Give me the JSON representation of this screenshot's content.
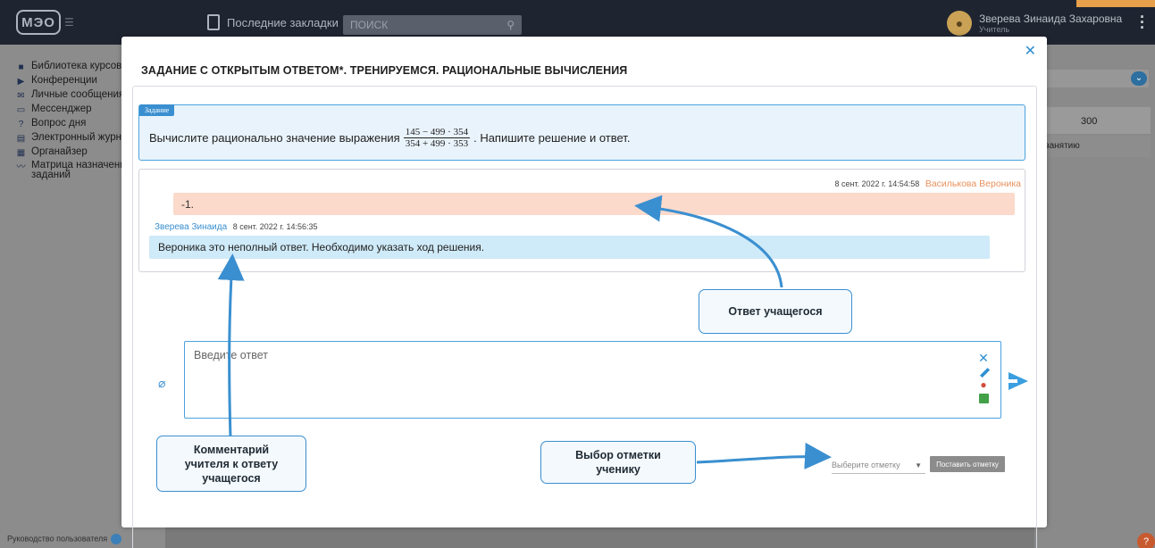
{
  "app": {
    "logo_text": "МЭО",
    "bookmarks_label": "Последние закладки",
    "search_placeholder": "ПОИСК",
    "user_name": "Зверева Зинаида Захаровна",
    "user_role": "Учитель"
  },
  "sidebar": {
    "items": [
      {
        "label": "Библиотека курсов",
        "icon": "book-icon"
      },
      {
        "label": "Конференции",
        "icon": "video-icon"
      },
      {
        "label": "Личные сообщения",
        "icon": "mail-icon"
      },
      {
        "label": "Мессенджер",
        "icon": "chat-icon"
      },
      {
        "label": "Вопрос дня",
        "icon": "question-icon"
      },
      {
        "label": "Электронный журнал",
        "icon": "journal-icon"
      },
      {
        "label": "Органайзер",
        "icon": "calendar-icon"
      },
      {
        "label": "Матрица назначения заданий",
        "icon": "chart-icon"
      }
    ],
    "guide_label": "Руководство пользователя"
  },
  "background": {
    "column_value": "300",
    "sub_label": "занятию"
  },
  "modal": {
    "title": "ЗАДАНИЕ С ОТКРЫТЫМ ОТВЕТОМ*. ТРЕНИРУЕМСЯ. РАЦИОНАЛЬНЫЕ ВЫЧИСЛЕНИЯ",
    "task": {
      "badge": "Задание",
      "text_before": "Вычислите рационально значение выражения",
      "numerator": "145 − 499 · 354",
      "denominator": "354 + 499 · 353",
      "text_after": ". Напишите решение и ответ."
    },
    "messages": {
      "student": {
        "timestamp": "8 сент. 2022 г. 14:54:58",
        "name": "Василькова Вероника",
        "text": "-1."
      },
      "teacher": {
        "name": "Зверева Зинаида",
        "timestamp": "8 сент. 2022 г. 14:56:35",
        "text": "Вероника это неполный ответ. Необходимо указать ход решения."
      }
    },
    "answer": {
      "placeholder": "Введите ответ"
    },
    "grade": {
      "select_placeholder": "Выберите отметку",
      "submit_label": "Поставить отметку"
    }
  },
  "callouts": {
    "student_answer": "Ответ учащегося",
    "teacher_comment_1": "Комментарий",
    "teacher_comment_2": "учителя к ответу",
    "teacher_comment_3": "учащегося",
    "grade_choice_1": "Выбор отметки",
    "grade_choice_2": "ученику"
  },
  "colors": {
    "accent": "#3a8fd0",
    "student_bubble": "#fbd9cb",
    "teacher_bubble": "#cfeaf8",
    "student_name": "#e8925e"
  }
}
